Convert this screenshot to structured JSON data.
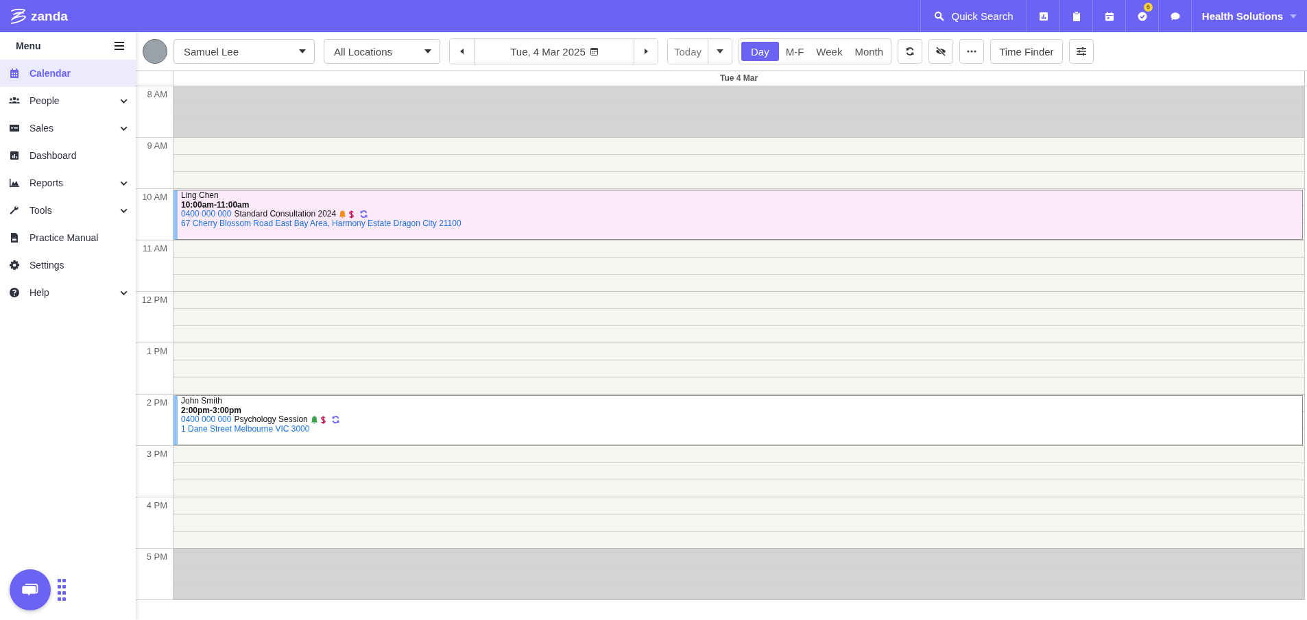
{
  "brand": {
    "name": "zanda"
  },
  "topbar": {
    "search_label": "Quick Search",
    "tasks_badge": "6",
    "account": "Health Solutions"
  },
  "sidebar": {
    "title": "Menu",
    "items": [
      {
        "label": "Calendar",
        "expandable": false,
        "selected": true
      },
      {
        "label": "People",
        "expandable": true,
        "selected": false
      },
      {
        "label": "Sales",
        "expandable": true,
        "selected": false
      },
      {
        "label": "Dashboard",
        "expandable": false,
        "selected": false
      },
      {
        "label": "Reports",
        "expandable": true,
        "selected": false
      },
      {
        "label": "Tools",
        "expandable": true,
        "selected": false
      },
      {
        "label": "Practice Manual",
        "expandable": false,
        "selected": false
      },
      {
        "label": "Settings",
        "expandable": false,
        "selected": false
      },
      {
        "label": "Help",
        "expandable": true,
        "selected": false
      }
    ]
  },
  "toolbar": {
    "practitioner": "Samuel Lee",
    "location": "All Locations",
    "date": "Tue, 4 Mar 2025",
    "today": "Today",
    "views": [
      {
        "label": "Day",
        "selected": true
      },
      {
        "label": "M-F",
        "selected": false
      },
      {
        "label": "Week",
        "selected": false
      },
      {
        "label": "Month",
        "selected": false
      }
    ],
    "time_finder": "Time Finder"
  },
  "calendar": {
    "day_header": "Tue 4 Mar",
    "hours": [
      {
        "label": "8 AM",
        "available": false
      },
      {
        "label": "9 AM",
        "available": true
      },
      {
        "label": "10 AM",
        "available": true,
        "appointments": [
          {
            "client": "Ling Chen",
            "time": "10:00am-11:00am",
            "phone": "0400 000 000",
            "service": "Standard Consultation 2024",
            "address": "67 Cherry Blossom Road East Bay Area, Harmony Estate Dragon City 21100",
            "color": "#fce9fb",
            "reminder": {
              "color": "#f08c1c"
            }
          }
        ]
      },
      {
        "label": "11 AM",
        "available": true
      },
      {
        "label": "12 PM",
        "available": true
      },
      {
        "label": "1 PM",
        "available": true
      },
      {
        "label": "2 PM",
        "available": true,
        "appointments": [
          {
            "client": "John Smith",
            "time": "2:00pm-3:00pm",
            "phone": "0400 000 000",
            "service": "Psychology Session",
            "address": "1 Dane Street Melbourne VIC 3000",
            "color": "#ffffff",
            "reminder": {
              "color": "#3ea34a"
            }
          }
        ]
      },
      {
        "label": "3 PM",
        "available": true
      },
      {
        "label": "4 PM",
        "available": true
      },
      {
        "label": "5 PM",
        "available": false
      }
    ]
  }
}
